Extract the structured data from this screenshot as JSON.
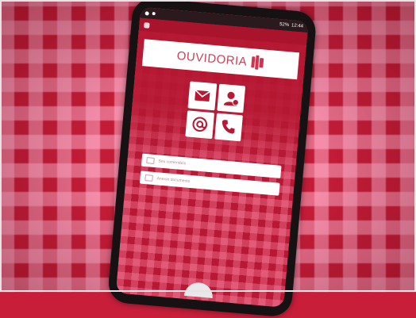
{
  "app": {
    "title": "OUVIDORIA"
  },
  "statusbar": {
    "battery": "52%",
    "time": "12:44"
  },
  "fields": [
    {
      "placeholder": "Seu comentário"
    },
    {
      "placeholder": "Anexar documento"
    }
  ],
  "tiles": [
    {
      "icon": "envelope-icon"
    },
    {
      "icon": "contact-icon"
    },
    {
      "icon": "at-icon"
    },
    {
      "icon": "phone-icon"
    }
  ],
  "colors": {
    "accent": "#c8435a",
    "background": "#c41c37"
  }
}
